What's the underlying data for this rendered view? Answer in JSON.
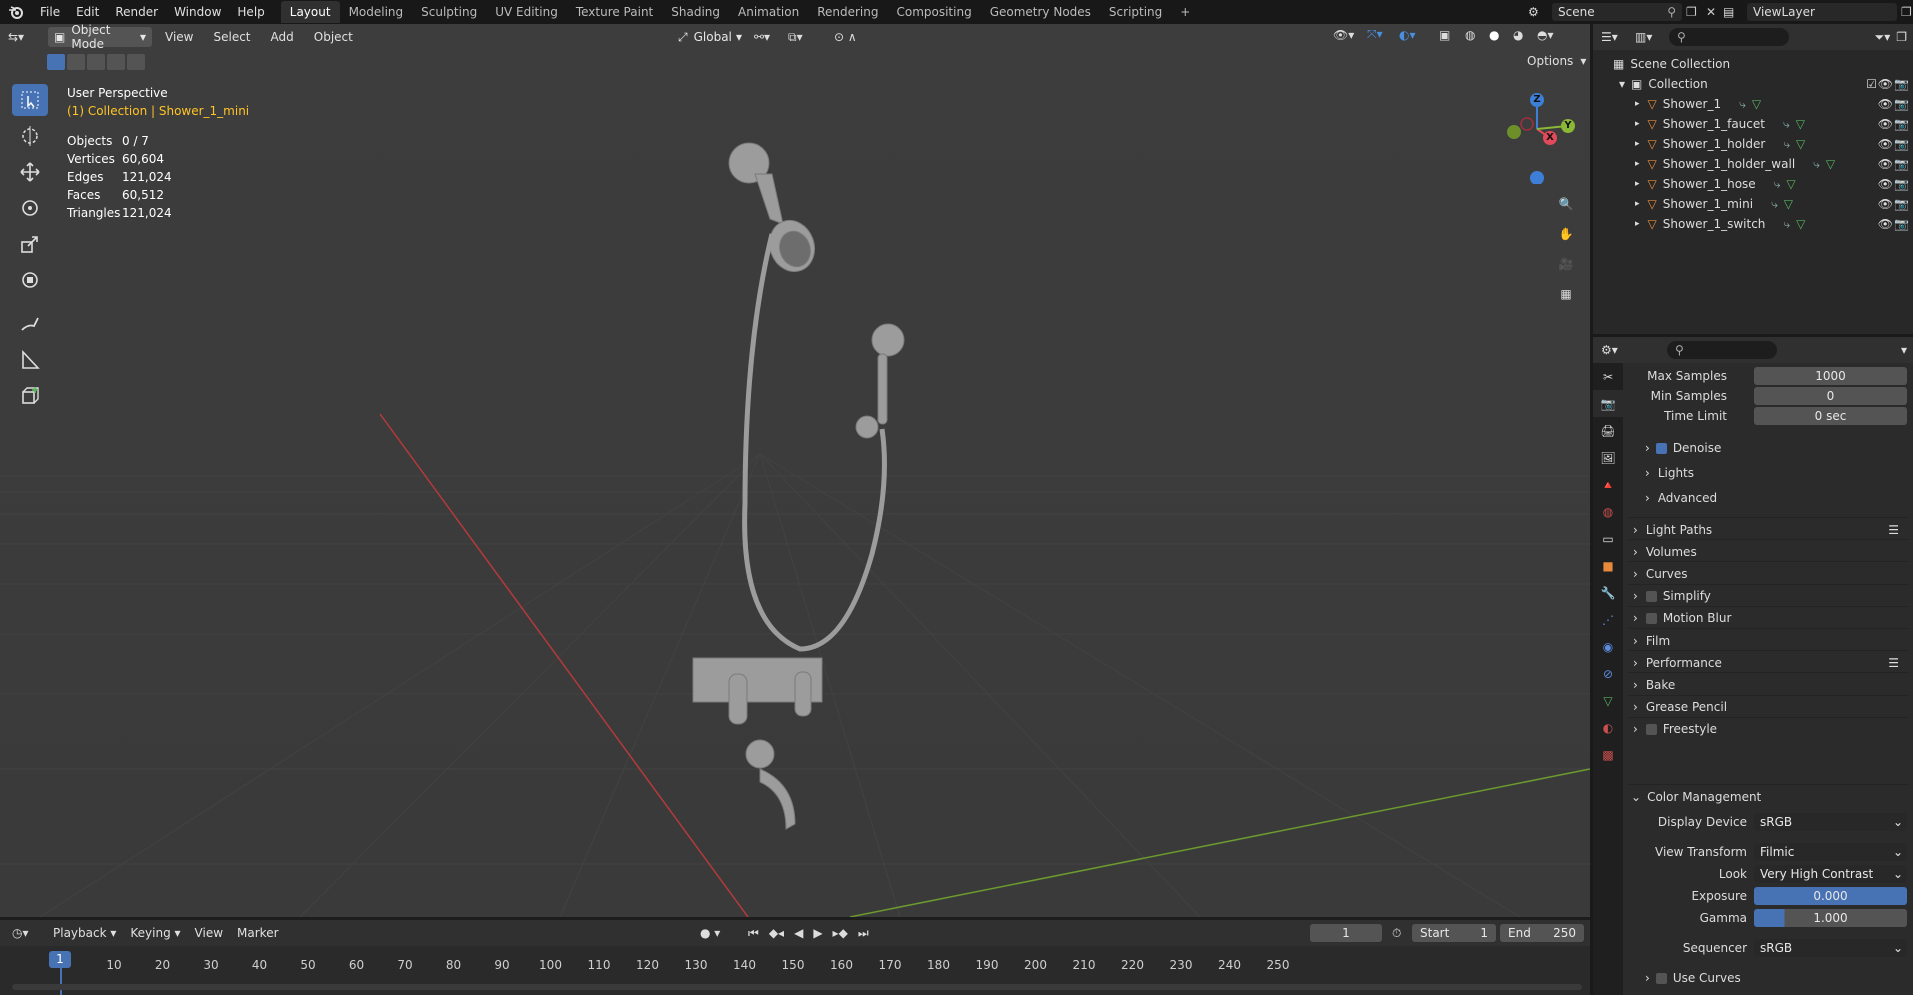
{
  "topbar": {
    "menus": [
      "File",
      "Edit",
      "Render",
      "Window",
      "Help"
    ],
    "workspaces": [
      "Layout",
      "Modeling",
      "Sculpting",
      "UV Editing",
      "Texture Paint",
      "Shading",
      "Animation",
      "Rendering",
      "Compositing",
      "Geometry Nodes",
      "Scripting"
    ],
    "active_workspace": "Layout",
    "add_tab": "+",
    "scene": "Scene",
    "view_layer": "ViewLayer"
  },
  "viewport": {
    "mode": "Object Mode",
    "menus": [
      "View",
      "Select",
      "Add",
      "Object"
    ],
    "transform_orientation": "Global",
    "options": "Options",
    "view_name": "User Perspective",
    "collection_line": "(1) Collection | Shower_1_mini",
    "stats": [
      {
        "label": "Objects",
        "value": "0 / 7"
      },
      {
        "label": "Vertices",
        "value": "60,604"
      },
      {
        "label": "Edges",
        "value": "121,024"
      },
      {
        "label": "Faces",
        "value": "60,512"
      },
      {
        "label": "Triangles",
        "value": "121,024"
      }
    ],
    "gizmo": {
      "z": "Z",
      "x": "X",
      "y": "Y"
    }
  },
  "outliner": {
    "root": "Scene Collection",
    "collection": "Collection",
    "items": [
      "Shower_1",
      "Shower_1_faucet",
      "Shower_1_holder",
      "Shower_1_holder_wall",
      "Shower_1_hose",
      "Shower_1_mini",
      "Shower_1_switch"
    ]
  },
  "properties": {
    "max_samples_label": "Max Samples",
    "max_samples": "1000",
    "min_samples_label": "Min Samples",
    "min_samples": "0",
    "time_limit_label": "Time Limit",
    "time_limit": "0 sec",
    "denoise": "Denoise",
    "lights": "Lights",
    "advanced": "Advanced",
    "panels": [
      "Light Paths",
      "Volumes",
      "Curves",
      "Simplify",
      "Motion Blur",
      "Film",
      "Performance",
      "Bake",
      "Grease Pencil",
      "Freestyle"
    ],
    "color_management": "Color Management",
    "display_device_label": "Display Device",
    "display_device": "sRGB",
    "view_transform_label": "View Transform",
    "view_transform": "Filmic",
    "look_label": "Look",
    "look": "Very High Contrast",
    "exposure_label": "Exposure",
    "exposure": "0.000",
    "gamma_label": "Gamma",
    "gamma": "1.000",
    "sequencer_label": "Sequencer",
    "sequencer": "sRGB",
    "use_curves": "Use Curves"
  },
  "timeline": {
    "menus": [
      "Playback",
      "Keying",
      "View",
      "Marker"
    ],
    "current_frame": "1",
    "start_label": "Start",
    "start": "1",
    "end_label": "End",
    "end": "250",
    "frame_marker": "1",
    "ticks": [
      "10",
      "20",
      "30",
      "40",
      "50",
      "60",
      "70",
      "80",
      "90",
      "100",
      "110",
      "120",
      "130",
      "140",
      "150",
      "160",
      "170",
      "180",
      "190",
      "200",
      "210",
      "220",
      "230",
      "240",
      "250"
    ]
  },
  "colors": {
    "accent": "#4772b3",
    "object_orange": "#e8893c",
    "mesh_green": "#55b35d",
    "x_red": "#e04a5a",
    "y_green": "#8ab836",
    "z_blue": "#3d7fd6"
  }
}
